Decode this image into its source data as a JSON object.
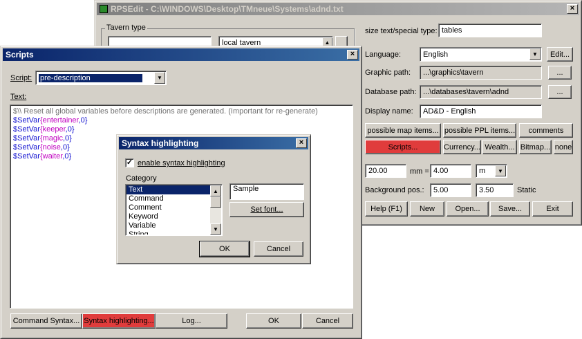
{
  "main_window": {
    "title": "RPSEdit - C:\\WINDOWS\\Desktop\\TMneue\\Systems\\adnd.txt",
    "group_title": "Tavern type",
    "tavern_field": "",
    "tavern_list_selected": "local tavern",
    "size_label": "size text/special type:",
    "size_value": "tables",
    "language_label": "Language:",
    "language_value": "English",
    "edit_button": "Edit...",
    "graphic_path_label": "Graphic path:",
    "graphic_path_value": "...\\graphics\\tavern",
    "database_path_label": "Database path:",
    "database_path_value": "...\\databases\\tavern\\adnd",
    "browse_button": "...",
    "display_name_label": "Display name:",
    "display_name_value": "AD&D - English",
    "buttons": {
      "possible_map": "possible map items...",
      "possible_ppl": "possible PPL items...",
      "comments": "comments",
      "scripts": "Scripts...",
      "currency": "Currency...",
      "wealth": "Wealth...",
      "bitmap": "Bitmap...",
      "none": "none",
      "help": "Help (F1)",
      "new": "New",
      "open": "Open...",
      "save": "Save...",
      "exit": "Exit"
    },
    "scale_value1": "20.00",
    "scale_mm_label": "mm =",
    "scale_value2": "4.00",
    "scale_unit": "m",
    "bg_pos_label": "Background pos.:",
    "bg_pos_x": "5.00",
    "bg_pos_y": "3.50",
    "static_label": "Static"
  },
  "scripts_window": {
    "title": "Scripts",
    "script_label": "Script:",
    "script_value": "pre-description",
    "text_label": "Text:",
    "code_comment": "$\\\\ Reset all global variables before descriptions are generated. (Important for re-generate)",
    "code_cmd": "$SetVar",
    "code_lines": [
      {
        "var": "entertainer",
        "val": ",0}"
      },
      {
        "var": "keeper",
        "val": ",0}"
      },
      {
        "var": "magic",
        "val": ",0}"
      },
      {
        "var": "noise",
        "val": ",0}"
      },
      {
        "var": "waiter",
        "val": ",0}"
      }
    ],
    "brace_open": "{",
    "buttons": {
      "command_syntax": "Command Syntax...",
      "syntax_highlighting": "Syntax highlighting...",
      "log": "Log...",
      "ok": "OK",
      "cancel": "Cancel"
    }
  },
  "syntax_dialog": {
    "title": "Syntax highlighting",
    "check_mark": "✓",
    "enable_label": "enable syntax highlighting",
    "category_label": "Category",
    "categories": [
      "Text",
      "Command",
      "Comment",
      "Keyword",
      "Variable",
      "String"
    ],
    "sample_text": "Sample",
    "set_font_button": "Set font...",
    "ok_button": "OK",
    "cancel_button": "Cancel"
  },
  "icons": {
    "close": "×",
    "dropdown": "▼",
    "scroll_up": "▲",
    "scroll_down": "▼"
  },
  "colors": {
    "title_active": "#0a246a",
    "title_inactive": "#808080",
    "red_button": "#e03c3c",
    "command": "#1010d0",
    "variable": "#c000c0",
    "comment": "#707070"
  }
}
